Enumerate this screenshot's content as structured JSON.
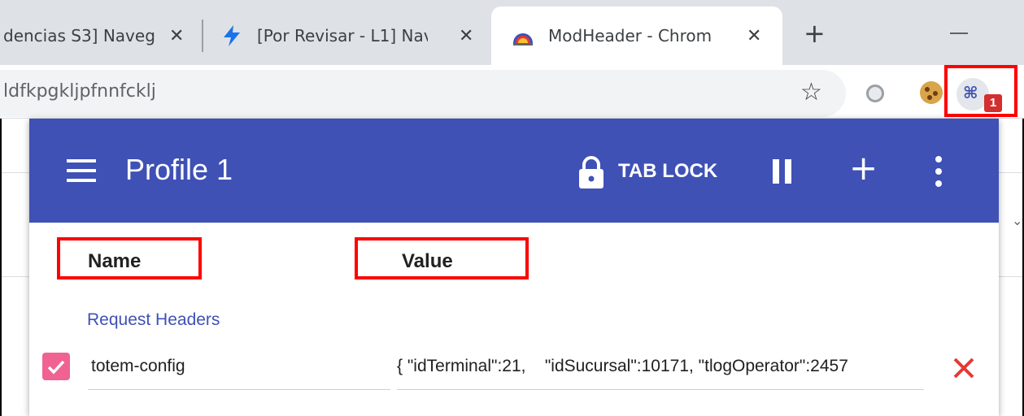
{
  "browser": {
    "tabs": [
      {
        "title": "dencias S3] Naveg",
        "active": false
      },
      {
        "title": "[Por Revisar - L1] Nav",
        "active": false
      },
      {
        "title": "ModHeader - Chrome",
        "active": true
      }
    ],
    "tab_close_glyph": "✕",
    "new_tab_glyph": "+",
    "url": "ldfkpgkljpfnnfcklj",
    "extensions": [
      "star-icon",
      "circle-extension-icon",
      "cookie-icon",
      "modheader-icon"
    ],
    "extension_badge": "1"
  },
  "popup": {
    "appbar": {
      "title": "Profile 1",
      "tab_lock_label": "TAB LOCK",
      "plus_glyph": "+",
      "color": "#3f51b5"
    },
    "columns": {
      "name": "Name",
      "value": "Value"
    },
    "section_label": "Request Headers",
    "headers": [
      {
        "enabled": true,
        "name": "totem-config",
        "value": "{ \"idTerminal\":21,    \"idSucursal\":10171, \"tlogOperator\":2457"
      }
    ],
    "accent_checkbox": "#f06292",
    "delete_color": "#e53935"
  },
  "annotations": {
    "highlight_color": "#ff0000"
  }
}
